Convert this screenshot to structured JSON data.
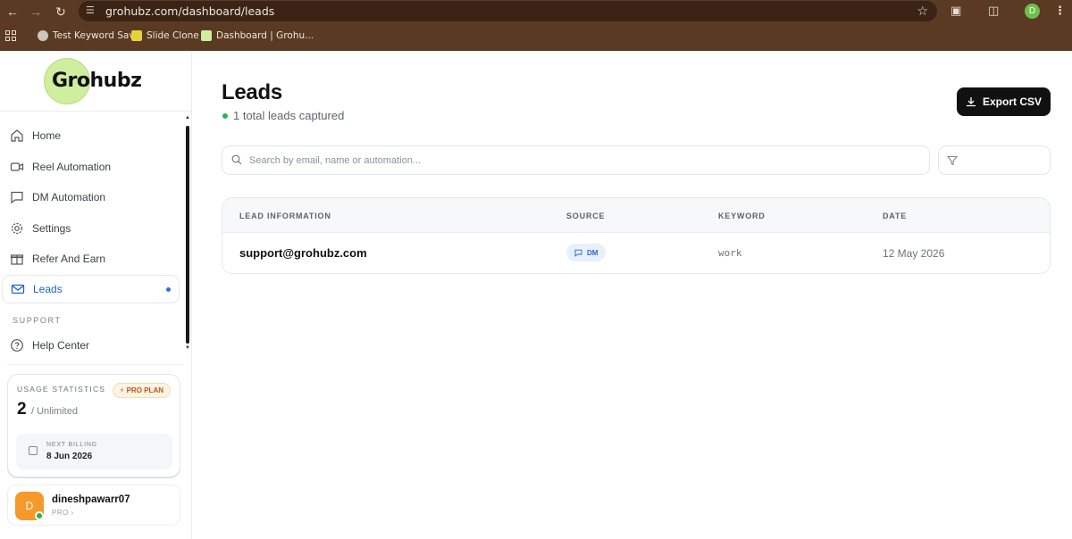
{
  "browser": {
    "url": "grohubz.com/dashboard/leads",
    "profile_initial": "D",
    "bookmarks": [
      {
        "label": "Test Keyword Save",
        "icon": "globe-icon"
      },
      {
        "label": "Slide Clone",
        "icon": "slide-icon"
      },
      {
        "label": "Dashboard | Grohu...",
        "icon": "grohubz-icon"
      }
    ]
  },
  "brand": {
    "logo_text": "Grohubz",
    "accent": "#cfee9e"
  },
  "sidebar": {
    "items": [
      {
        "label": "Home",
        "icon": "home-icon"
      },
      {
        "label": "Reel Automation",
        "icon": "video-icon"
      },
      {
        "label": "DM Automation",
        "icon": "message-icon"
      },
      {
        "label": "Settings",
        "icon": "gear-icon"
      },
      {
        "label": "Refer And Earn",
        "icon": "gift-icon"
      },
      {
        "label": "Leads",
        "icon": "mail-icon",
        "active": true
      }
    ],
    "support_label": "SUPPORT",
    "help": {
      "label": "Help Center",
      "icon": "help-circle-icon"
    }
  },
  "usage": {
    "title": "USAGE STATISTICS",
    "badge": "PRO PLAN",
    "count": "2",
    "limit": "/ Unlimited",
    "billing_label": "NEXT BILLING",
    "billing_date": "8 Jun 2026"
  },
  "user": {
    "initial": "D",
    "name": "dineshpawarr07",
    "plan": "PRO"
  },
  "main": {
    "title": "Leads",
    "subtitle": "1 total leads captured",
    "export_label": "Export CSV",
    "search_placeholder": "Search by email, name or automation...",
    "table": {
      "columns": [
        "LEAD INFORMATION",
        "SOURCE",
        "KEYWORD",
        "DATE"
      ],
      "rows": [
        {
          "email": "support@grohubz.com",
          "source": "DM",
          "keyword": "work",
          "date": "12 May 2026"
        }
      ]
    }
  }
}
